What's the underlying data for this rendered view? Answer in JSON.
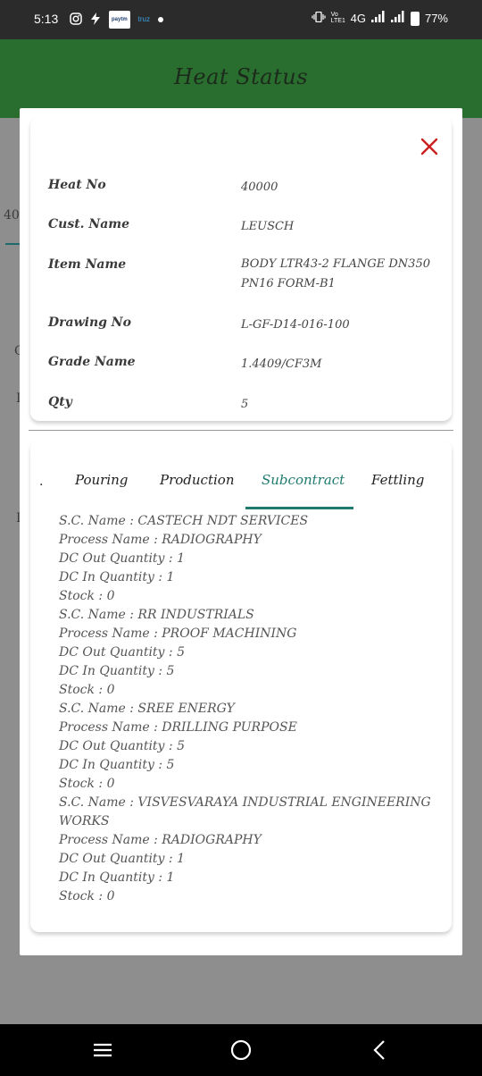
{
  "status_bar": {
    "time": "5:13",
    "icons": [
      "instagram-icon",
      "bolt-icon",
      "paytm-icon",
      "truz-icon",
      "dot-icon"
    ],
    "paytm_label": "paytm",
    "truz_label": "truz",
    "network": "4G",
    "volte": "Vo LTE1",
    "battery": "77%"
  },
  "app_bar": {
    "title": "Heat Status"
  },
  "background": {
    "fragment1": "40",
    "fragment2": "C",
    "fragment3": "I",
    "fragment4": "I"
  },
  "dialog": {
    "details": [
      {
        "label": "Heat No",
        "value": "40000"
      },
      {
        "label": "Cust. Name",
        "value": "LEUSCH"
      },
      {
        "label": "Item Name",
        "value": "BODY LTR43-2 FLANGE DN350 PN16 FORM-B1"
      },
      {
        "label": "Drawing No",
        "value": "L-GF-D14-016-100"
      },
      {
        "label": "Grade Name",
        "value": "1.4409/CF3M"
      },
      {
        "label": "Qty",
        "value": "5"
      }
    ],
    "tabs": [
      {
        "label": "Pouring",
        "active": false
      },
      {
        "label": "Production",
        "active": false
      },
      {
        "label": "Subcontract",
        "active": true
      },
      {
        "label": "Fettling",
        "active": false
      }
    ],
    "tab_dot": ".",
    "subcontract_lines": [
      "S.C. Name : CASTECH NDT SERVICES",
      "Process Name : RADIOGRAPHY",
      "DC Out Quantity : 1",
      "DC In Quantity : 1",
      "Stock : 0",
      "S.C. Name : RR INDUSTRIALS",
      "Process Name : PROOF MACHINING",
      "DC Out Quantity : 5",
      "DC In Quantity : 5",
      "Stock : 0",
      "S.C. Name : SREE ENERGY",
      "Process Name : DRILLING PURPOSE",
      "DC Out Quantity : 5",
      "DC In Quantity : 5",
      "Stock : 0",
      "S.C. Name : VISVESVARAYA INDUSTRIAL ENGINEERING WORKS",
      "Process Name : RADIOGRAPHY",
      "DC Out Quantity : 1",
      "DC In Quantity : 1",
      "Stock : 0"
    ]
  },
  "colors": {
    "accent": "#1e7b6e",
    "app_bar": "#2a6e2f",
    "close": "#cc1f1f"
  }
}
